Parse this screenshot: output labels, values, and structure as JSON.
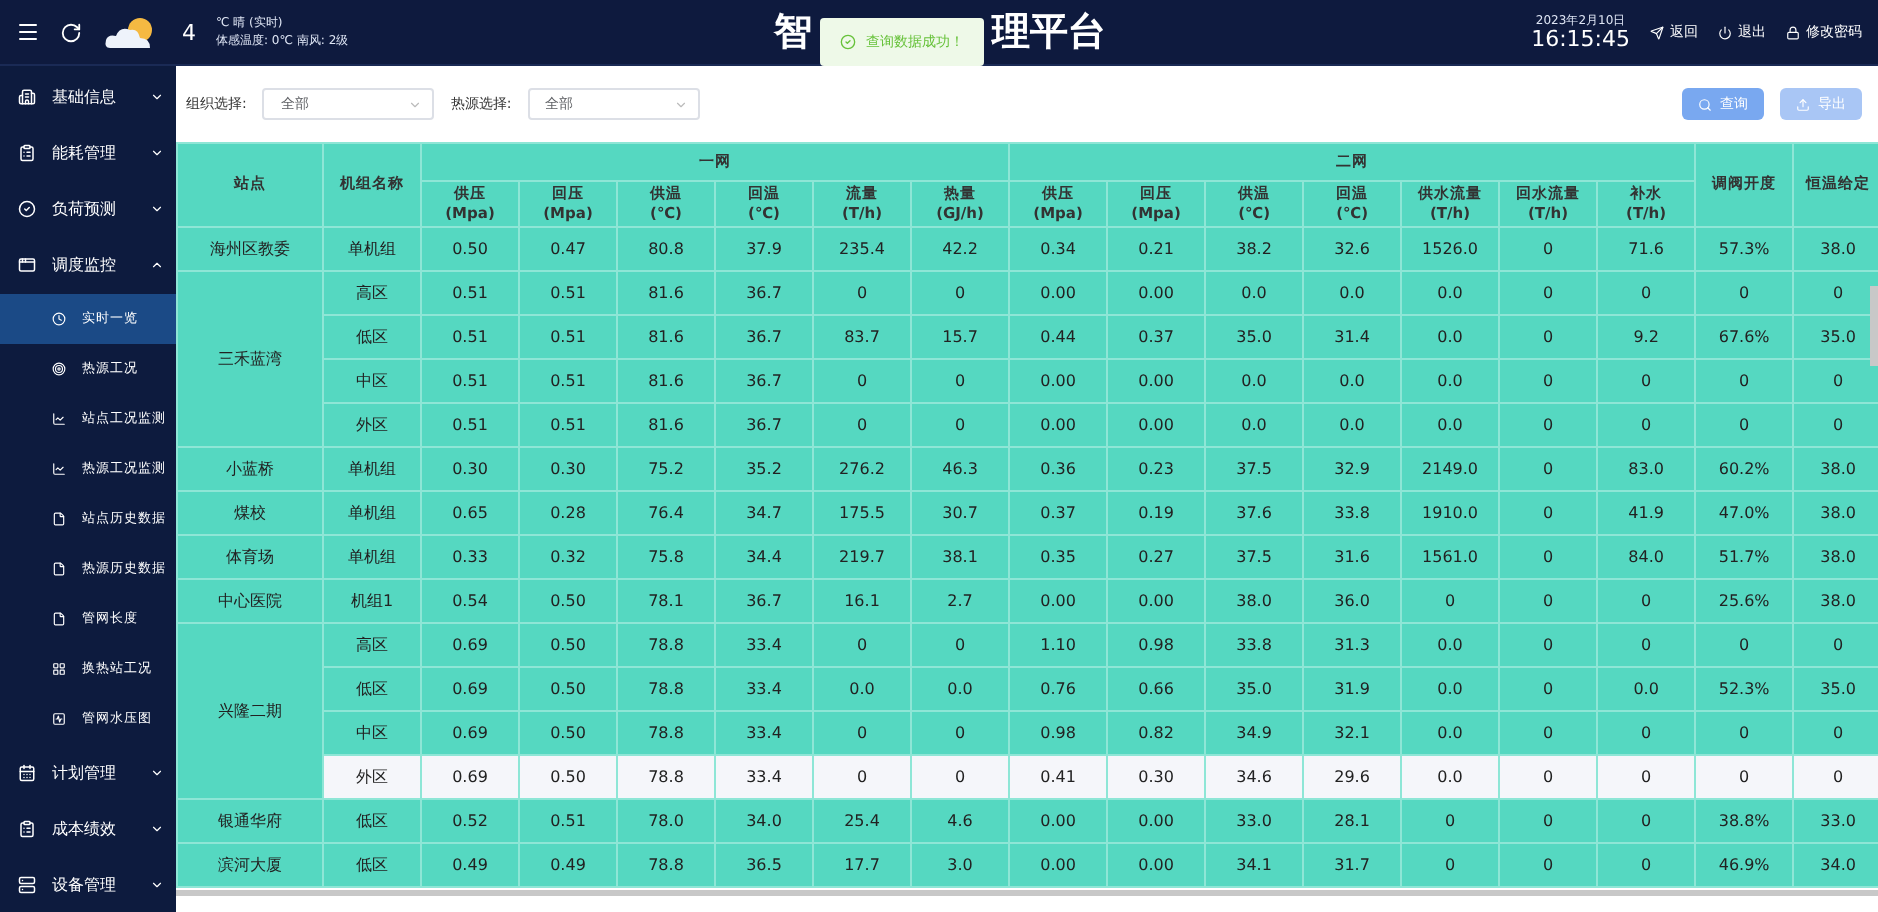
{
  "header": {
    "weather": {
      "temperature": "4",
      "condition": "℃ 晴 (实时)",
      "detail": "体感温度: 0℃ 南风: 2级"
    },
    "title_parts": [
      "智",
      "理平台"
    ],
    "toast": {
      "kind": "success",
      "text": "查询数据成功！"
    },
    "date": "2023年2月10日",
    "time": "16:15:45",
    "links": [
      {
        "kind": "back",
        "label": "返回"
      },
      {
        "kind": "logout",
        "label": "退出"
      },
      {
        "kind": "lock",
        "label": "修改密码"
      }
    ]
  },
  "sidebar": {
    "items": [
      {
        "label": "基础信息",
        "expanded": false
      },
      {
        "label": "能耗管理",
        "expanded": false
      },
      {
        "label": "负荷预测",
        "expanded": false
      },
      {
        "label": "调度监控",
        "expanded": true,
        "children": [
          {
            "label": "实时一览",
            "selected": true
          },
          {
            "label": "热源工况",
            "selected": false
          },
          {
            "label": "站点工况监测",
            "selected": false
          },
          {
            "label": "热源工况监测",
            "selected": false
          },
          {
            "label": "站点历史数据",
            "selected": false
          },
          {
            "label": "热源历史数据",
            "selected": false
          },
          {
            "label": "管网长度",
            "selected": false
          },
          {
            "label": "换热站工况",
            "selected": false
          },
          {
            "label": "管网水压图",
            "selected": false
          }
        ]
      },
      {
        "label": "计划管理",
        "expanded": false
      },
      {
        "label": "成本绩效",
        "expanded": false
      },
      {
        "label": "设备管理",
        "expanded": false
      }
    ]
  },
  "filters": [
    {
      "label": "组织选择:",
      "value": "全部"
    },
    {
      "label": "热源选择:",
      "value": "全部"
    }
  ],
  "actions": [
    {
      "kind": "search",
      "label": "查询"
    },
    {
      "kind": "export",
      "label": "导出"
    }
  ],
  "table": {
    "station_header": "站点",
    "unit_header": "机组名称",
    "groups": [
      {
        "label": "一网",
        "columns": [
          [
            "供压",
            "(Mpa)"
          ],
          [
            "回压",
            "(Mpa)"
          ],
          [
            "供温",
            "(℃)"
          ],
          [
            "回温",
            "(℃)"
          ],
          [
            "流量",
            "(T/h)"
          ],
          [
            "热量",
            "(GJ/h)"
          ]
        ]
      },
      {
        "label": "二网",
        "columns": [
          [
            "供压",
            "(Mpa)"
          ],
          [
            "回压",
            "(Mpa)"
          ],
          [
            "供温",
            "(℃)"
          ],
          [
            "回温",
            "(℃)"
          ],
          [
            "供水流量",
            "(T/h)"
          ],
          [
            "回水流量",
            "(T/h)"
          ],
          [
            "补水",
            "(T/h)"
          ]
        ]
      }
    ],
    "extra_headers": [
      "调阀开度",
      "恒温给定"
    ],
    "stations": [
      {
        "name": "海州区教委",
        "units": [
          {
            "name": "单机组",
            "selected": false,
            "values": [
              "0.50",
              "0.47",
              "80.8",
              "37.9",
              "235.4",
              "42.2",
              "0.34",
              "0.21",
              "38.2",
              "32.6",
              "1526.0",
              "0",
              "71.6",
              "57.3%",
              "38.0"
            ]
          }
        ]
      },
      {
        "name": "三禾蓝湾",
        "units": [
          {
            "name": "高区",
            "selected": false,
            "values": [
              "0.51",
              "0.51",
              "81.6",
              "36.7",
              "0",
              "0",
              "0.00",
              "0.00",
              "0.0",
              "0.0",
              "0.0",
              "0",
              "0",
              "0",
              "0"
            ]
          },
          {
            "name": "低区",
            "selected": false,
            "values": [
              "0.51",
              "0.51",
              "81.6",
              "36.7",
              "83.7",
              "15.7",
              "0.44",
              "0.37",
              "35.0",
              "31.4",
              "0.0",
              "0",
              "9.2",
              "67.6%",
              "35.0"
            ]
          },
          {
            "name": "中区",
            "selected": false,
            "values": [
              "0.51",
              "0.51",
              "81.6",
              "36.7",
              "0",
              "0",
              "0.00",
              "0.00",
              "0.0",
              "0.0",
              "0.0",
              "0",
              "0",
              "0",
              "0"
            ]
          },
          {
            "name": "外区",
            "selected": false,
            "values": [
              "0.51",
              "0.51",
              "81.6",
              "36.7",
              "0",
              "0",
              "0.00",
              "0.00",
              "0.0",
              "0.0",
              "0.0",
              "0",
              "0",
              "0",
              "0"
            ]
          }
        ]
      },
      {
        "name": "小蓝桥",
        "units": [
          {
            "name": "单机组",
            "selected": false,
            "values": [
              "0.30",
              "0.30",
              "75.2",
              "35.2",
              "276.2",
              "46.3",
              "0.36",
              "0.23",
              "37.5",
              "32.9",
              "2149.0",
              "0",
              "83.0",
              "60.2%",
              "38.0"
            ]
          }
        ]
      },
      {
        "name": "煤校",
        "units": [
          {
            "name": "单机组",
            "selected": false,
            "values": [
              "0.65",
              "0.28",
              "76.4",
              "34.7",
              "175.5",
              "30.7",
              "0.37",
              "0.19",
              "37.6",
              "33.8",
              "1910.0",
              "0",
              "41.9",
              "47.0%",
              "38.0"
            ]
          }
        ]
      },
      {
        "name": "体育场",
        "units": [
          {
            "name": "单机组",
            "selected": false,
            "values": [
              "0.33",
              "0.32",
              "75.8",
              "34.4",
              "219.7",
              "38.1",
              "0.35",
              "0.27",
              "37.5",
              "31.6",
              "1561.0",
              "0",
              "84.0",
              "51.7%",
              "38.0"
            ]
          }
        ]
      },
      {
        "name": "中心医院",
        "units": [
          {
            "name": "机组1",
            "selected": false,
            "values": [
              "0.54",
              "0.50",
              "78.1",
              "36.7",
              "16.1",
              "2.7",
              "0.00",
              "0.00",
              "38.0",
              "36.0",
              "0",
              "0",
              "0",
              "25.6%",
              "38.0"
            ]
          }
        ]
      },
      {
        "name": "兴隆二期",
        "units": [
          {
            "name": "高区",
            "selected": false,
            "values": [
              "0.69",
              "0.50",
              "78.8",
              "33.4",
              "0",
              "0",
              "1.10",
              "0.98",
              "33.8",
              "31.3",
              "0.0",
              "0",
              "0",
              "0",
              "0"
            ]
          },
          {
            "name": "低区",
            "selected": false,
            "values": [
              "0.69",
              "0.50",
              "78.8",
              "33.4",
              "0.0",
              "0.0",
              "0.76",
              "0.66",
              "35.0",
              "31.9",
              "0.0",
              "0",
              "0.0",
              "52.3%",
              "35.0"
            ]
          },
          {
            "name": "中区",
            "selected": false,
            "values": [
              "0.69",
              "0.50",
              "78.8",
              "33.4",
              "0",
              "0",
              "0.98",
              "0.82",
              "34.9",
              "32.1",
              "0.0",
              "0",
              "0",
              "0",
              "0"
            ]
          },
          {
            "name": "外区",
            "selected": true,
            "values": [
              "0.69",
              "0.50",
              "78.8",
              "33.4",
              "0",
              "0",
              "0.41",
              "0.30",
              "34.6",
              "29.6",
              "0.0",
              "0",
              "0",
              "0",
              "0"
            ]
          }
        ]
      },
      {
        "name": "银通华府",
        "units": [
          {
            "name": "低区",
            "selected": false,
            "values": [
              "0.52",
              "0.51",
              "78.0",
              "34.0",
              "25.4",
              "4.6",
              "0.00",
              "0.00",
              "33.0",
              "28.1",
              "0",
              "0",
              "0",
              "38.8%",
              "33.0"
            ]
          }
        ]
      },
      {
        "name": "滨河大厦",
        "units": [
          {
            "name": "低区",
            "selected": false,
            "values": [
              "0.49",
              "0.49",
              "78.8",
              "36.5",
              "17.7",
              "3.0",
              "0.00",
              "0.00",
              "34.1",
              "31.7",
              "0",
              "0",
              "0",
              "46.9%",
              "34.0"
            ]
          }
        ]
      }
    ]
  }
}
